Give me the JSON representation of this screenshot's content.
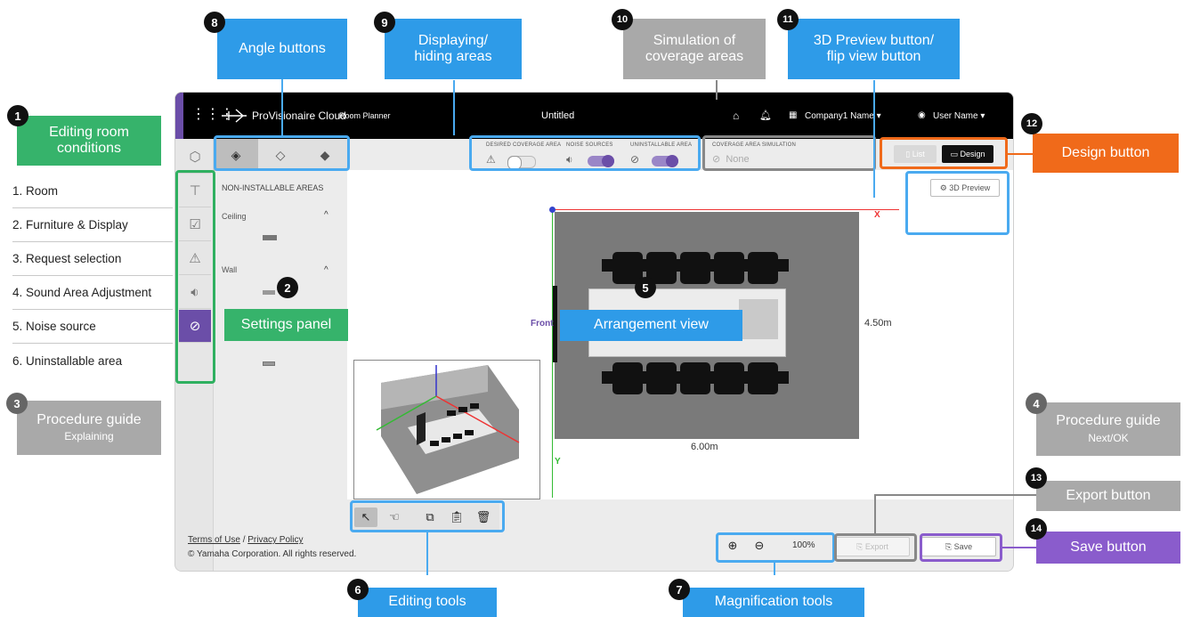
{
  "app": {
    "logo_text": "ProVisionaire Cloud",
    "module": "Room Planner",
    "doc_title": "Untitled",
    "company": "Company1 Name",
    "user": "User Name"
  },
  "settings_panel": {
    "heading": "NON-INSTALLABLE AREAS",
    "ceiling_label": "Ceiling",
    "wall_label": "Wall"
  },
  "area_toggles": {
    "desired_label": "DESIRED COVERAGE AREA",
    "noise_label": "NOISE SOURCES",
    "uninstallable_label": "UNINSTALLABLE AREA",
    "desired_on": false,
    "noise_on": true,
    "uninstallable_on": true
  },
  "simulation": {
    "label": "COVERAGE AREA SIMULATION",
    "value": "None"
  },
  "view_mode": {
    "list_label": "List",
    "design_label": "Design",
    "preview_label": "3D Preview"
  },
  "room": {
    "front_label": "Front",
    "width_label": "6.00m",
    "depth_label": "4.50m",
    "x_axis": "X",
    "y_axis": "Y"
  },
  "zoom": {
    "level": "100%"
  },
  "actions": {
    "export_label": "Export",
    "save_label": "Save"
  },
  "footer": {
    "terms": "Terms of Use",
    "sep": "/",
    "privacy": "Privacy Policy",
    "copyright": "© Yamaha Corporation. All rights reserved."
  },
  "steps": [
    "1. Room",
    "2. Furniture & Display",
    "3. Request selection",
    "4. Sound Area Adjustment",
    "5. Noise source",
    "6. Uninstallable area"
  ],
  "callouts": {
    "c1": "Editing room conditions",
    "c2": "Settings panel",
    "c3_title": "Procedure guide",
    "c3_sub": "Explaining",
    "c4_title": "Procedure guide",
    "c4_sub": "Next/OK",
    "c5": "Arrangement view",
    "c6": "Editing tools",
    "c7": "Magnification tools",
    "c8": "Angle buttons",
    "c9_l1": "Displaying/",
    "c9_l2": "hiding areas",
    "c10_l1": "Simulation of",
    "c10_l2": "coverage areas",
    "c11_l1": "3D Preview button/",
    "c11_l2": "flip view button",
    "c12": "Design button",
    "c13": "Export button",
    "c14": "Save button",
    "n1": "1",
    "n2": "2",
    "n3": "3",
    "n4": "4",
    "n5": "5",
    "n6": "6",
    "n7": "7",
    "n8": "8",
    "n9": "9",
    "n10": "10",
    "n11": "11",
    "n12": "12",
    "n13": "13",
    "n14": "14"
  },
  "colors": {
    "accent_purple": "#6b4ea8",
    "callout_blue": "#2e9be8",
    "callout_green": "#36b36b",
    "callout_orange": "#f06a1a",
    "callout_purple": "#8a5ccc",
    "callout_gray": "#a9a9a9"
  }
}
